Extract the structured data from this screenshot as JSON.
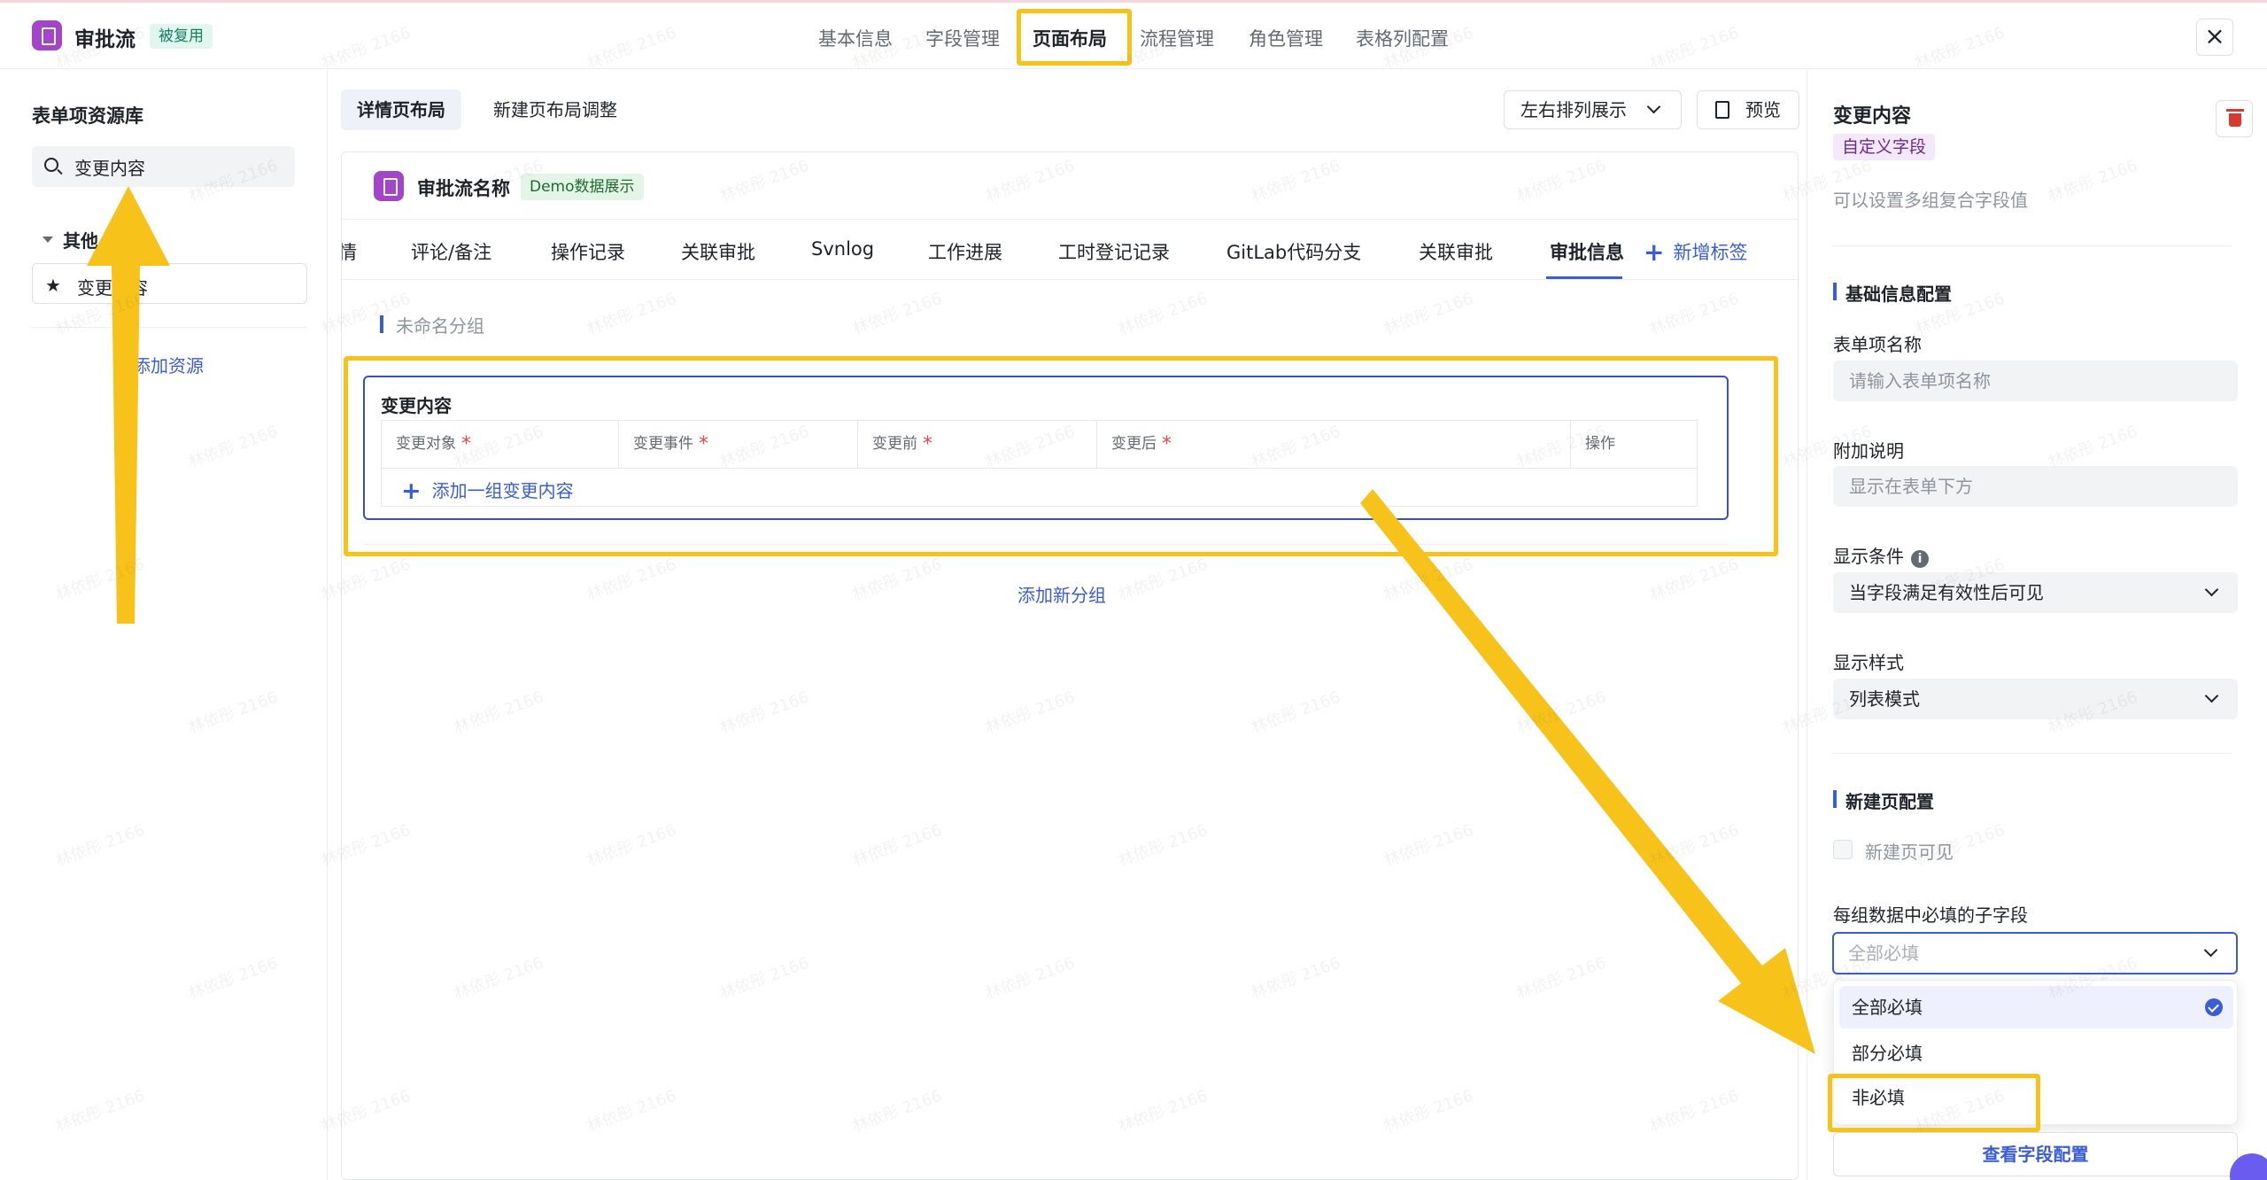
{
  "app": {
    "title": "审批流",
    "badge": "被复用"
  },
  "top_tabs": [
    {
      "label": "基本信息",
      "active": false
    },
    {
      "label": "字段管理",
      "active": false
    },
    {
      "label": "页面布局",
      "active": true
    },
    {
      "label": "流程管理",
      "active": false
    },
    {
      "label": "角色管理",
      "active": false
    },
    {
      "label": "表格列配置",
      "active": false
    }
  ],
  "close_icon": "close-icon",
  "left_panel": {
    "title": "表单项资源库",
    "search_value": "变更内容",
    "group_label": "其他",
    "item_label": "变更内容",
    "add_resource": "添加资源"
  },
  "layout_tabs": [
    {
      "label": "详情页布局",
      "active": true
    },
    {
      "label": "新建页布局调整",
      "active": false
    }
  ],
  "toolbar": {
    "arrange_select": "左右排列展示",
    "preview": "预览"
  },
  "canvas": {
    "name": "审批流名称",
    "badge": "Demo数据展示",
    "tabs": [
      "情",
      "评论/备注",
      "操作记录",
      "关联审批",
      "Svnlog",
      "工作进展",
      "工时登记记录",
      "GitLab代码分支",
      "关联审批",
      "审批信息"
    ],
    "active_tab": "审批信息",
    "add_tab": "新增标签",
    "group_title": "未命名分组",
    "field_card": {
      "title": "变更内容",
      "columns": [
        {
          "label": "变更对象",
          "required": true
        },
        {
          "label": "变更事件",
          "required": true
        },
        {
          "label": "变更前",
          "required": true
        },
        {
          "label": "变更后",
          "required": true
        },
        {
          "label": "操作",
          "required": false
        }
      ],
      "add_row": "添加一组变更内容"
    },
    "add_group": "添加新分组"
  },
  "right_panel": {
    "title": "变更内容",
    "tag": "自定义字段",
    "desc": "可以设置多组复合字段值",
    "basic_section": "基础信息配置",
    "name_label": "表单项名称",
    "name_placeholder": "请输入表单项名称",
    "note_label": "附加说明",
    "note_placeholder": "显示在表单下方",
    "condition_label": "显示条件",
    "condition_value": "当字段满足有效性后可见",
    "style_label": "显示样式",
    "style_value": "列表模式",
    "new_page_section": "新建页配置",
    "new_page_visible": "新建页可见",
    "required_label": "每组数据中必填的子字段",
    "required_placeholder": "全部必填",
    "options": [
      {
        "label": "全部必填",
        "selected": true
      },
      {
        "label": "部分必填",
        "selected": false
      },
      {
        "label": "非必填",
        "selected": false
      }
    ],
    "view_config": "查看字段配置"
  },
  "watermark": "林依彤 2166",
  "colors": {
    "accent": "#3a5cd6",
    "annotation": "#f7c31b",
    "logo": "#a445c9",
    "danger": "#d83931"
  }
}
